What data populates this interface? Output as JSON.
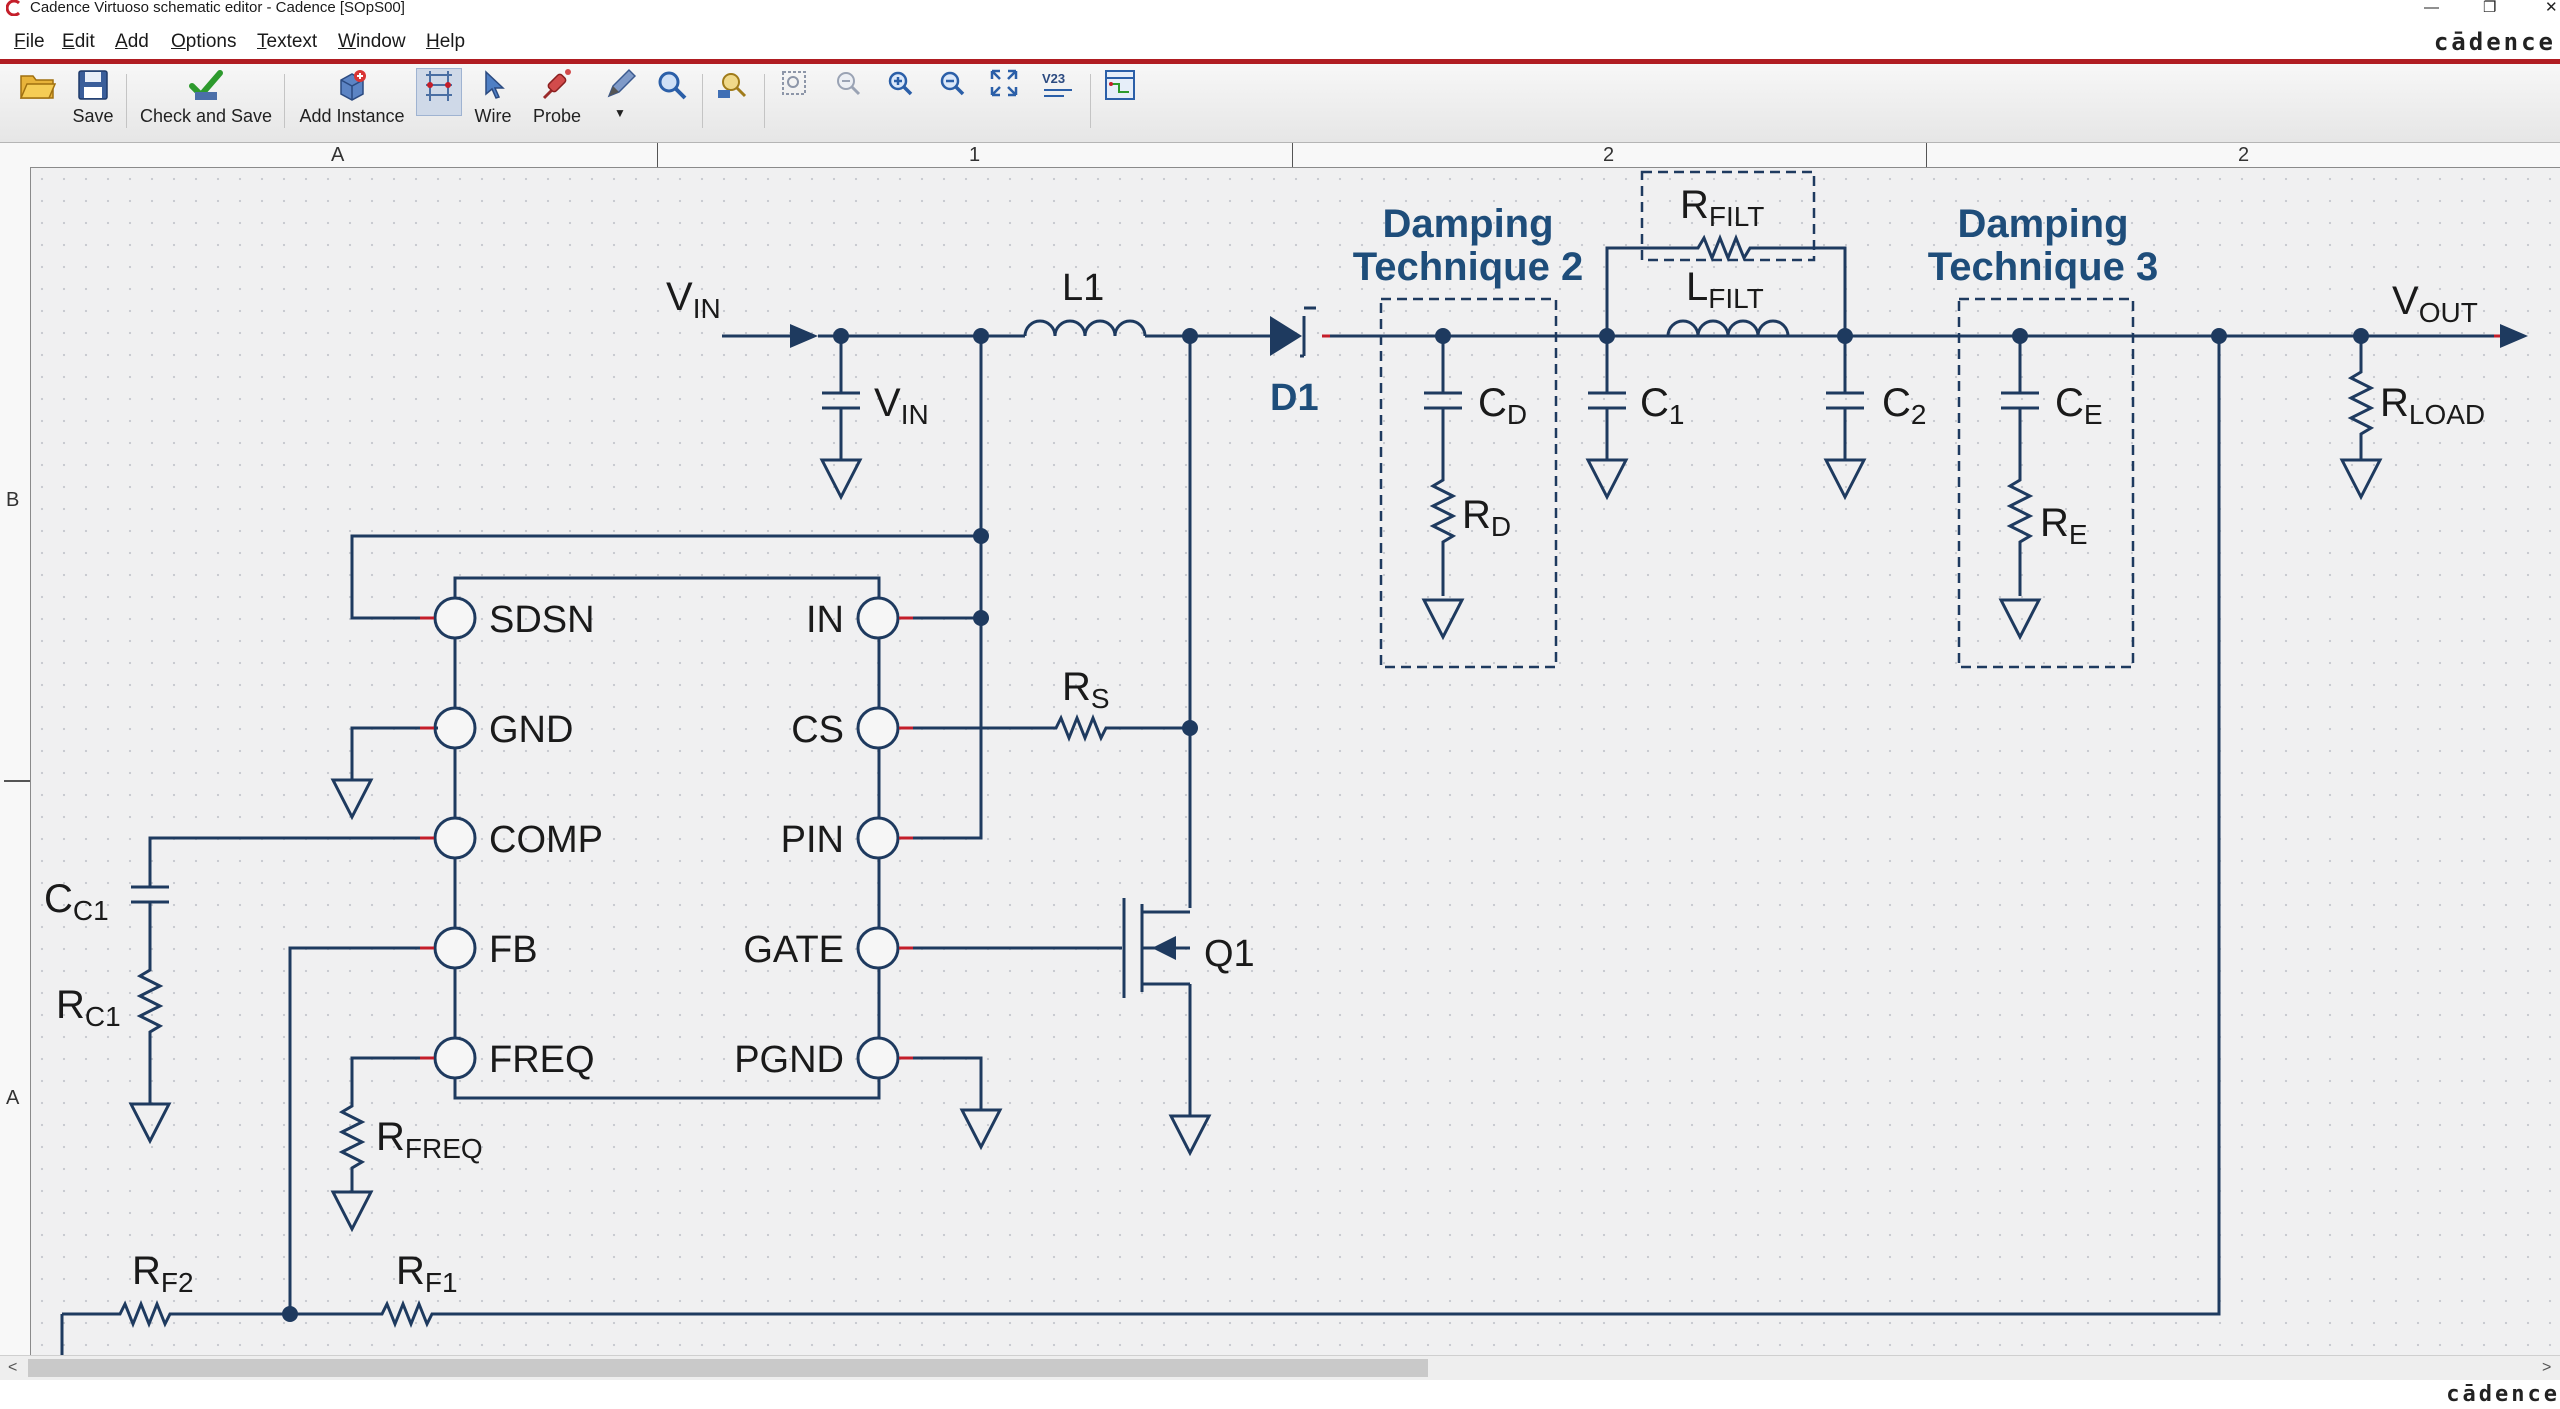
{
  "window": {
    "title": "Cadence Virtuoso schematic editor - Cadence [SOpS00]"
  },
  "menu": [
    {
      "key": "F",
      "rest": "ile"
    },
    {
      "key": "E",
      "rest": "dit"
    },
    {
      "key": "A",
      "rest": "dd"
    },
    {
      "key": "O",
      "rest": "ptions"
    },
    {
      "key": "T",
      "rest": "extext"
    },
    {
      "key": "W",
      "rest": "indow"
    },
    {
      "key": "H",
      "rest": "elp"
    }
  ],
  "brand": "cādence",
  "brand_bottom": "cādence",
  "toolbar": {
    "save": "Save",
    "check_and_save": "Check and Save",
    "add_instance": "Add Instance",
    "wire": "Wire",
    "probe": "Probe",
    "v23": "V23"
  },
  "ruler_top": [
    "A",
    "1",
    "2",
    "2"
  ],
  "ruler_left": [
    "B",
    "A"
  ],
  "schematic": {
    "labels": {
      "vin_main": "V",
      "vin_main_sub": "IN",
      "vin_cap": "V",
      "vin_cap_sub": "IN",
      "l1": "L1",
      "d1": "D1",
      "damp2_line1": "Damping",
      "damp2_line2": "Technique 2",
      "damp3_line1": "Damping",
      "damp3_line2": "Technique 3",
      "rfilt": "R",
      "rfilt_sub": "FILT",
      "lfilt": "L",
      "lfilt_sub": "FILT",
      "cd": "C",
      "cd_sub": "D",
      "rd": "R",
      "rd_sub": "D",
      "c1": "C",
      "c1_sub": "1",
      "c2": "C",
      "c2_sub": "2",
      "ce": "C",
      "ce_sub": "E",
      "re": "R",
      "re_sub": "E",
      "vout": "V",
      "vout_sub": "OUT",
      "rload": "R",
      "rload_sub": "LOAD",
      "rs": "R",
      "rs_sub": "S",
      "q1": "Q1",
      "cc1": "C",
      "cc1_sub": "C1",
      "rc1": "R",
      "rc1_sub": "C1",
      "rfreq": "R",
      "rfreq_sub": "FREQ",
      "rf2": "R",
      "rf2_sub": "F2",
      "rf1": "R",
      "rf1_sub": "F1"
    },
    "ic_pins_left": [
      "SDSN",
      "GND",
      "COMP",
      "FB",
      "FREQ"
    ],
    "ic_pins_right": [
      "IN",
      "CS",
      "PIN",
      "GATE",
      "PGND"
    ]
  }
}
